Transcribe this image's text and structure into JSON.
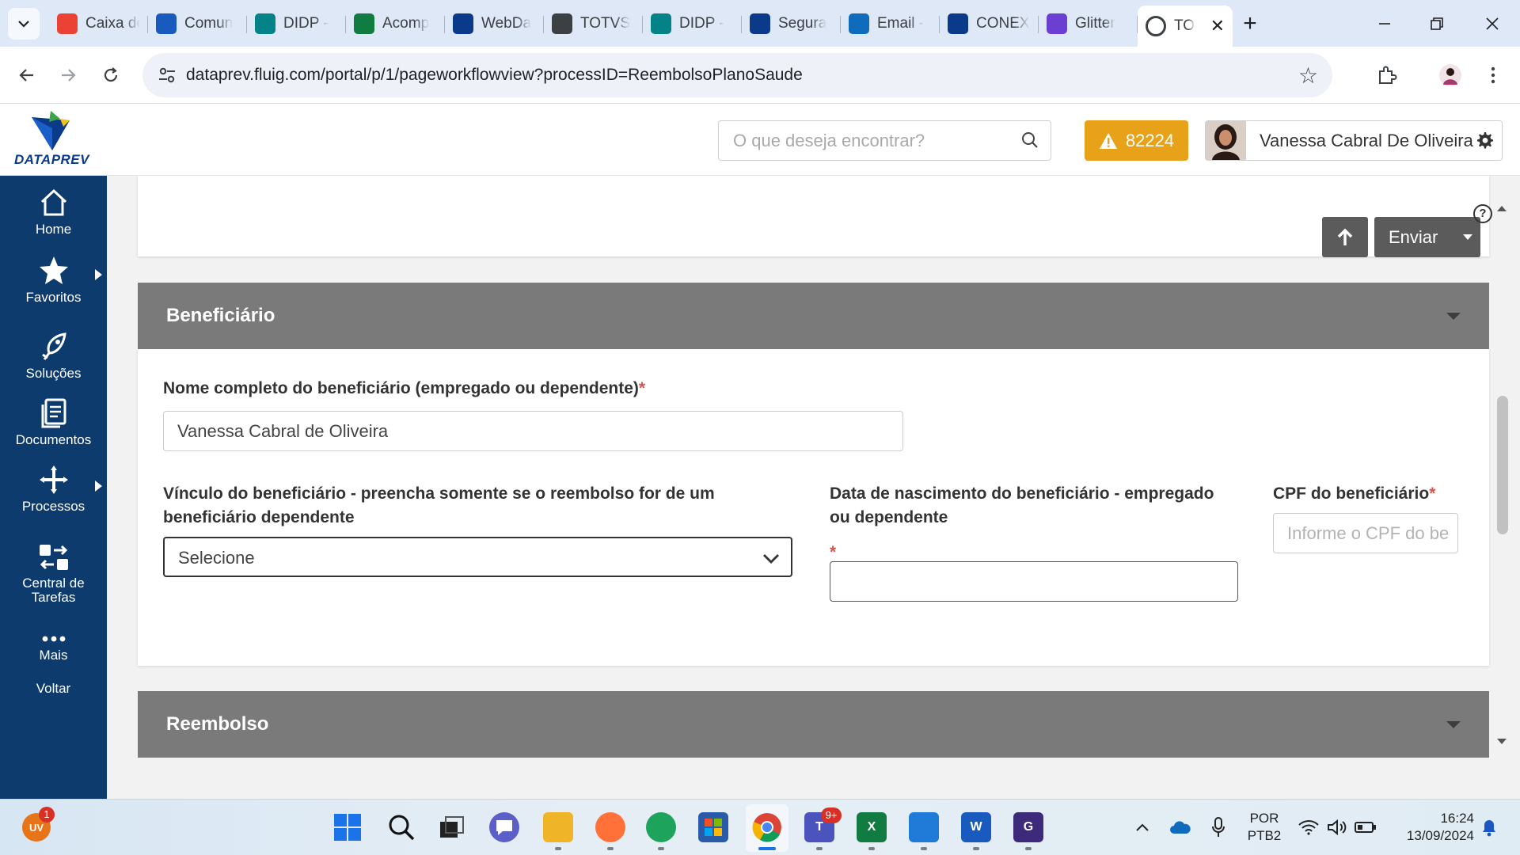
{
  "browser": {
    "tabs": [
      {
        "label": "Caixa de",
        "icon": "gmail-icon",
        "color": "#ea4335"
      },
      {
        "label": "Comun",
        "icon": "word-icon",
        "color": "#185abd"
      },
      {
        "label": "DIDP -",
        "icon": "sharepoint-icon",
        "color": "#038387"
      },
      {
        "label": "Acomp",
        "icon": "excel-icon",
        "color": "#107c41"
      },
      {
        "label": "WebDa",
        "icon": "dataprev-icon",
        "color": "#0b3a8a"
      },
      {
        "label": "TOTVS",
        "icon": "totvs-icon",
        "color": "#3c4043"
      },
      {
        "label": "DIDP -",
        "icon": "sharepoint-icon",
        "color": "#038387"
      },
      {
        "label": "Segura",
        "icon": "dataprev-icon",
        "color": "#0b3a8a"
      },
      {
        "label": "Email -",
        "icon": "outlook-icon",
        "color": "#0f6cbd"
      },
      {
        "label": "CONEX",
        "icon": "dataprev-icon",
        "color": "#0b3a8a"
      },
      {
        "label": "Glitter",
        "icon": "glitter-icon",
        "color": "#6b3fd1"
      }
    ],
    "active_tab": {
      "label": "TO",
      "icon": "totvs-icon",
      "close": "✕"
    },
    "new_tab": "+",
    "url": "dataprev.fluig.com/portal/p/1/pageworkflowview?processID=ReembolsoPlanoSaude"
  },
  "header": {
    "logo_text": "DATAPREV",
    "search_placeholder": "O que deseja encontrar?",
    "alert_count": "82224",
    "user_name": "Vanessa Cabral De Oliveira"
  },
  "sidebar": {
    "items": [
      {
        "label": "Home",
        "icon": "home-icon"
      },
      {
        "label": "Favoritos",
        "icon": "star-icon"
      },
      {
        "label": "Soluções",
        "icon": "rocket-icon"
      },
      {
        "label": "Documentos",
        "icon": "documents-icon"
      },
      {
        "label": "Processos",
        "icon": "processes-icon"
      },
      {
        "label": "Central de Tarefas",
        "icon": "tasks-icon"
      },
      {
        "label": "Mais",
        "icon": "more-icon"
      },
      {
        "label": "Voltar",
        "icon": ""
      }
    ]
  },
  "toolbar": {
    "send_label": "Enviar",
    "help": "?"
  },
  "beneficiario": {
    "title": "Beneficiário",
    "nome_label": "Nome completo do beneficiário (empregado ou dependente)",
    "nome_value": "Vanessa Cabral de Oliveira",
    "vinculo_label_1": "Vínculo do beneficiário - preencha somente se o reembolso for de um",
    "vinculo_label_2": "beneficiário dependente",
    "vinculo_value": "Selecione",
    "nascimento_label_1": "Data de nascimento do beneficiário - empregado",
    "nascimento_label_2": "ou dependente",
    "nascimento_value": "",
    "cpf_label": "CPF do beneficiário",
    "cpf_placeholder": "Informe o CPF do be",
    "required_mark": "*"
  },
  "reembolso": {
    "title": "Reembolso"
  },
  "taskbar": {
    "user_initials": "UV",
    "user_badge": "1",
    "teams_badge": "9+",
    "lang_1": "POR",
    "lang_2": "PTB2",
    "time": "16:24",
    "date": "13/09/2024"
  },
  "colors": {
    "sidebar_bg": "#0d3b6e",
    "alert_bg": "#e8a21a",
    "panel_head_bg": "#7a7a7a",
    "button_bg": "#5b5b5b",
    "required": "#d9534f"
  }
}
